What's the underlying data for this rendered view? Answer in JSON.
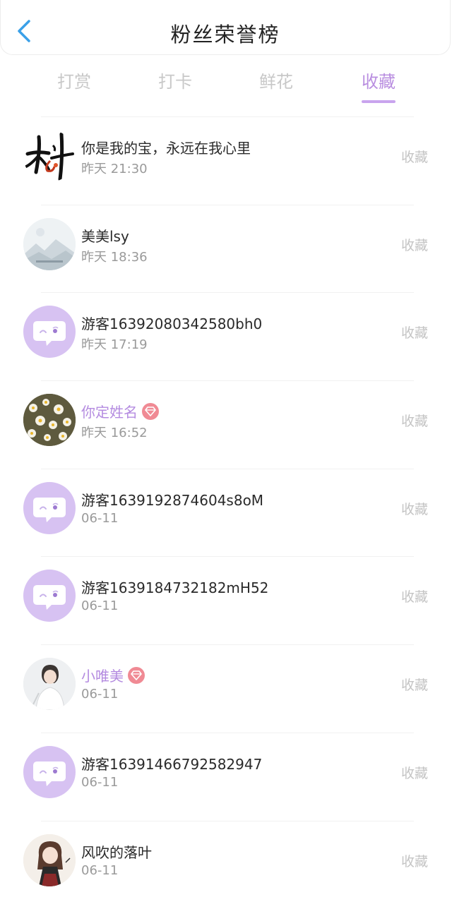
{
  "header": {
    "title": "粉丝荣誉榜"
  },
  "tabs": [
    {
      "label": "打赏",
      "active": false
    },
    {
      "label": "打卡",
      "active": false
    },
    {
      "label": "鲜花",
      "active": false
    },
    {
      "label": "收藏",
      "active": true
    }
  ],
  "colors": {
    "accent": "#b98ee0",
    "back_arrow": "#3aa0e8",
    "vip_badge": "#f08a94",
    "default_avatar_bg": "#d7c2f2"
  },
  "fans": [
    {
      "name": "你是我的宝，永远在我心里",
      "time": "昨天 21:30",
      "action": "收藏",
      "vip": false,
      "avatar": "calligraphy-avatar"
    },
    {
      "name": "美美lsy",
      "time": "昨天 18:36",
      "action": "收藏",
      "vip": false,
      "avatar": "landscape-avatar"
    },
    {
      "name": "游客16392080342580bh0",
      "time": "昨天 17:19",
      "action": "收藏",
      "vip": false,
      "avatar": "default-chat-avatar"
    },
    {
      "name": "你定姓名",
      "time": "昨天 16:52",
      "action": "收藏",
      "vip": true,
      "avatar": "flowers-avatar"
    },
    {
      "name": "游客1639192874604s8oM",
      "time": "06-11",
      "action": "收藏",
      "vip": false,
      "avatar": "default-chat-avatar"
    },
    {
      "name": "游客1639184732182mH52",
      "time": "06-11",
      "action": "收藏",
      "vip": false,
      "avatar": "default-chat-avatar"
    },
    {
      "name": "小唯美",
      "time": "06-11",
      "action": "收藏",
      "vip": true,
      "avatar": "person-avatar"
    },
    {
      "name": "游客16391466792582947",
      "time": "06-11",
      "action": "收藏",
      "vip": false,
      "avatar": "default-chat-avatar"
    },
    {
      "name": "风吹的落叶",
      "time": "06-11",
      "action": "收藏",
      "vip": false,
      "avatar": "girl-avatar"
    }
  ]
}
